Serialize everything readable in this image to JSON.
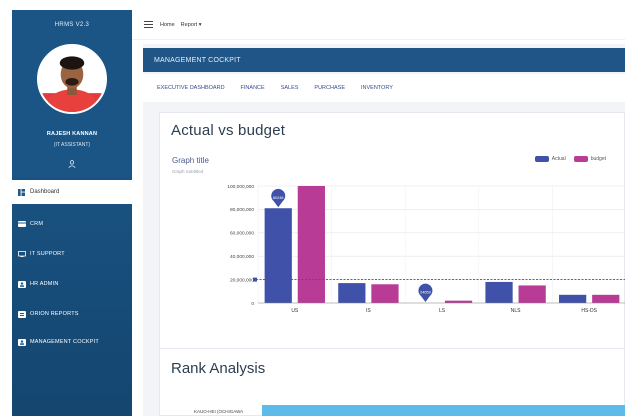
{
  "sidebar": {
    "brand": "HRMS V2.3",
    "user_name": "RAJESH KANNAN",
    "user_role": "(IT ASSISTANT)",
    "active_item": "Dashboard",
    "items": [
      "CRM",
      "IT SUPPORT",
      "HR ADMIN",
      "ORION REPORTS",
      "MANAGEMENT COCKPIT"
    ],
    "colors": {
      "bg": "#1d5a8e",
      "active_bg": "#ffffff"
    }
  },
  "topbar": {
    "home": "Home",
    "report": "Report ▾"
  },
  "main": {
    "header": "MANAGEMENT COCKPIT",
    "tabs": [
      "EXECUTIVE DASHBOARD",
      "FINANCE",
      "SALES",
      "PURCHASE",
      "INVENTORY"
    ]
  },
  "card1": {
    "title": "Actual vs budget",
    "graph_title": "Graph title",
    "graph_subtitle": "Graph Subtitled"
  },
  "card2": {
    "title": "Rank Analysis",
    "first_label": "KAUO-HEI (OCHIGAWA"
  },
  "chart_data": {
    "type": "bar",
    "categories": [
      "US",
      "IS",
      "LS",
      "NLS",
      "HS-DS"
    ],
    "series": [
      {
        "name": "Actual",
        "color": "#3f51a8",
        "values": [
          81000000,
          17000000,
          0,
          18000000,
          7000000
        ]
      },
      {
        "name": "Budget",
        "color": "#b83b96",
        "values": [
          100000000,
          16000000,
          2000000,
          15000000,
          7000000
        ]
      }
    ],
    "ylim": [
      0,
      100000000
    ],
    "yticks": [
      "0",
      "20,000,000",
      "40,000,000",
      "60,000,000",
      "80,000,000",
      "100,000,000"
    ],
    "average_line": 20000000,
    "average_color": "#3f51a8",
    "markers": [
      {
        "category": "US",
        "series": "Actual",
        "label": "80248"
      },
      {
        "category": "LS",
        "series": "Actual",
        "label": "24659"
      }
    ],
    "legend": [
      "Actual",
      "budget"
    ],
    "legend_position": "top-right",
    "grid": true
  }
}
